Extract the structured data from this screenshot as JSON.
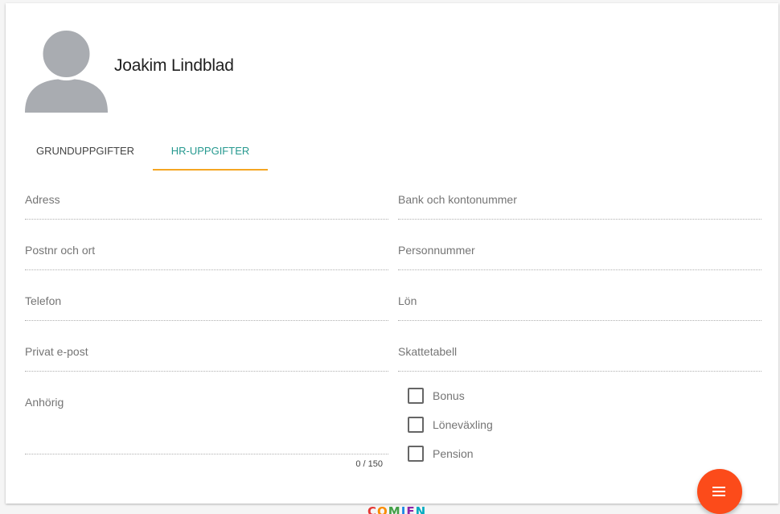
{
  "profile": {
    "name": "Joakim Lindblad"
  },
  "tabs": [
    {
      "label": "GRUNDUPPGIFTER",
      "active": false
    },
    {
      "label": "HR-UPPGIFTER",
      "active": true
    }
  ],
  "colors": {
    "accent": "#26998f",
    "tab_indicator": "#f5a623",
    "fab": "#fc4b1a"
  },
  "form": {
    "left": [
      {
        "label": "Adress",
        "value": ""
      },
      {
        "label": "Postnr och ort",
        "value": ""
      },
      {
        "label": "Telefon",
        "value": ""
      },
      {
        "label": "Privat e-post",
        "value": ""
      }
    ],
    "right": [
      {
        "label": "Bank och kontonummer",
        "value": ""
      },
      {
        "label": "Personnummer",
        "value": ""
      },
      {
        "label": "Lön",
        "value": ""
      },
      {
        "label": "Skattetabell",
        "value": ""
      }
    ],
    "relative": {
      "label": "Anhörig",
      "value": "",
      "counter": "0 / 150"
    },
    "checkboxes": [
      {
        "label": "Bonus",
        "checked": false
      },
      {
        "label": "Löneväxling",
        "checked": false
      },
      {
        "label": "Pension",
        "checked": false
      }
    ]
  },
  "fab": {
    "icon": "menu-icon"
  },
  "footer": {
    "logo": "COMIEN"
  }
}
